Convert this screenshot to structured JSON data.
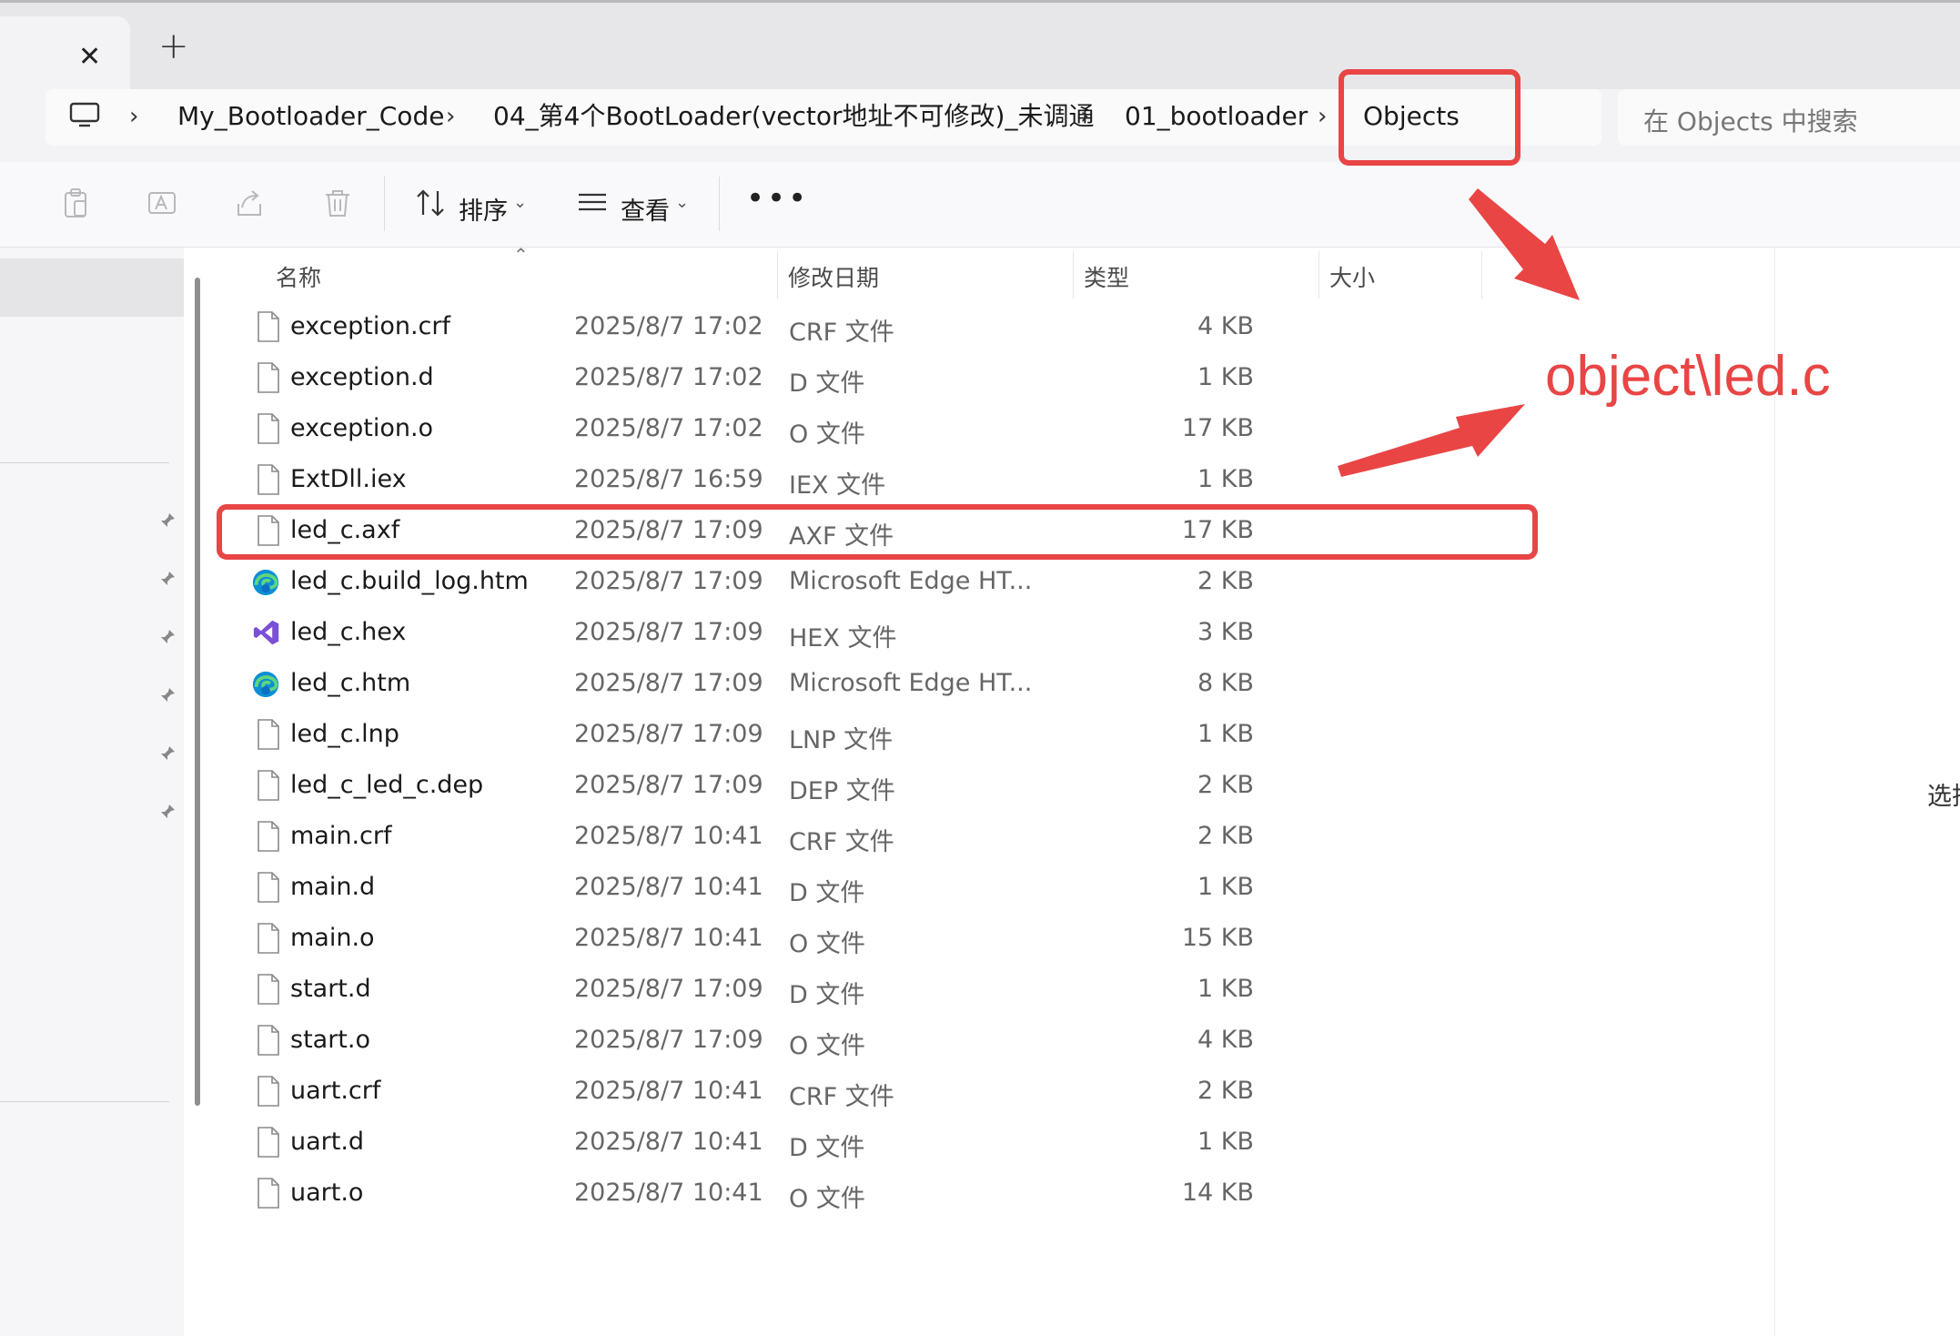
{
  "tabs": {
    "close_glyph": "✕",
    "new_tab_glyph": "+"
  },
  "breadcrumb": {
    "sep": "›",
    "items": [
      "My_Bootloader_Code",
      "04_第4个BootLoader(vector地址不可修改)_未调通",
      "01_bootloader",
      "Objects"
    ]
  },
  "search": {
    "placeholder": "在 Objects 中搜索"
  },
  "toolbar": {
    "icons": [
      "paste-icon",
      "rename-icon",
      "share-icon",
      "delete-icon"
    ],
    "sort_label": "排序",
    "view_label": "查看",
    "more_label": "•••"
  },
  "columns": {
    "name": "名称",
    "date": "修改日期",
    "type": "类型",
    "size": "大小"
  },
  "files": [
    {
      "name": "exception.crf",
      "date": "2025/8/7 17:02",
      "type": "CRF 文件",
      "size": "4 KB",
      "icon": "file"
    },
    {
      "name": "exception.d",
      "date": "2025/8/7 17:02",
      "type": "D 文件",
      "size": "1 KB",
      "icon": "file"
    },
    {
      "name": "exception.o",
      "date": "2025/8/7 17:02",
      "type": "O 文件",
      "size": "17 KB",
      "icon": "file"
    },
    {
      "name": "ExtDll.iex",
      "date": "2025/8/7 16:59",
      "type": "IEX 文件",
      "size": "1 KB",
      "icon": "file"
    },
    {
      "name": "led_c.axf",
      "date": "2025/8/7 17:09",
      "type": "AXF 文件",
      "size": "17 KB",
      "icon": "file"
    },
    {
      "name": "led_c.build_log.htm",
      "date": "2025/8/7 17:09",
      "type": "Microsoft Edge HT...",
      "size": "2 KB",
      "icon": "edge"
    },
    {
      "name": "led_c.hex",
      "date": "2025/8/7 17:09",
      "type": "HEX 文件",
      "size": "3 KB",
      "icon": "vs"
    },
    {
      "name": "led_c.htm",
      "date": "2025/8/7 17:09",
      "type": "Microsoft Edge HT...",
      "size": "8 KB",
      "icon": "edge"
    },
    {
      "name": "led_c.lnp",
      "date": "2025/8/7 17:09",
      "type": "LNP 文件",
      "size": "1 KB",
      "icon": "file"
    },
    {
      "name": "led_c_led_c.dep",
      "date": "2025/8/7 17:09",
      "type": "DEP 文件",
      "size": "2 KB",
      "icon": "file"
    },
    {
      "name": "main.crf",
      "date": "2025/8/7 10:41",
      "type": "CRF 文件",
      "size": "2 KB",
      "icon": "file"
    },
    {
      "name": "main.d",
      "date": "2025/8/7 10:41",
      "type": "D 文件",
      "size": "1 KB",
      "icon": "file"
    },
    {
      "name": "main.o",
      "date": "2025/8/7 10:41",
      "type": "O 文件",
      "size": "15 KB",
      "icon": "file"
    },
    {
      "name": "start.d",
      "date": "2025/8/7 17:09",
      "type": "D 文件",
      "size": "1 KB",
      "icon": "file"
    },
    {
      "name": "start.o",
      "date": "2025/8/7 17:09",
      "type": "O 文件",
      "size": "4 KB",
      "icon": "file"
    },
    {
      "name": "uart.crf",
      "date": "2025/8/7 10:41",
      "type": "CRF 文件",
      "size": "2 KB",
      "icon": "file"
    },
    {
      "name": "uart.d",
      "date": "2025/8/7 10:41",
      "type": "D 文件",
      "size": "1 KB",
      "icon": "file"
    },
    {
      "name": "uart.o",
      "date": "2025/8/7 10:41",
      "type": "O 文件",
      "size": "14 KB",
      "icon": "file"
    }
  ],
  "highlighted_file": "led_c.axf",
  "details_pane_cut_text": "选择",
  "annotation": {
    "text": "object\\led.c",
    "color": "#e94545"
  }
}
